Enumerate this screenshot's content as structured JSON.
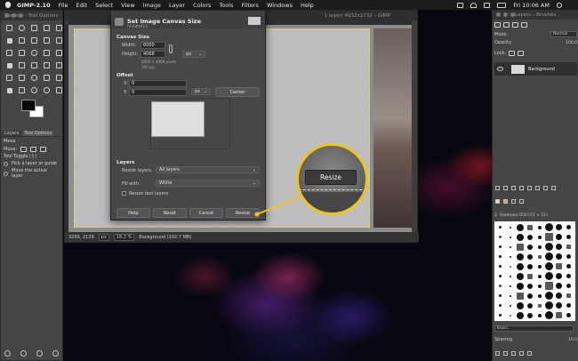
{
  "menubar": {
    "app_name": "GIMP-2.10",
    "items": [
      "File",
      "Edit",
      "Select",
      "View",
      "Image",
      "Layer",
      "Colors",
      "Tools",
      "Filters",
      "Windows",
      "Help"
    ],
    "clock": "Fri 10:06 AM"
  },
  "toolbox": {
    "title": "Toolbox - Tool Options",
    "tabs": [
      "Layers",
      "Tool Options"
    ],
    "tool_name": "Move",
    "move_label": "Move:",
    "toggle_label": "Tool Toggle  (⇧)",
    "option1": "Pick a layer or guide",
    "option2": "Move the active layer"
  },
  "image_window": {
    "title": "[Untitled]-4.0 (RGB color 8-bit gamma integer, GIMP built-in sRGB, 1 layer) 4032x2732 – GIMP",
    "title_visible": "1 layer) 4032x2732 – GIMP",
    "status": {
      "coords": "3289, 2139",
      "unit": "px",
      "zoom": "18.2 %",
      "info": "Background (102.7 MB)"
    }
  },
  "dialog": {
    "title": "Set Image Canvas Size",
    "subtitle": "[Untitled]-4",
    "canvas_size": {
      "heading": "Canvas Size",
      "width_label": "Width:",
      "width_value": "6000",
      "height_label": "Height:",
      "height_value": "4068",
      "unit": "px",
      "info_line1": "6000 × 4068 pixels",
      "info_line2": "300 ppi"
    },
    "offset": {
      "heading": "Offset",
      "x_label": "X:",
      "x_value": "0",
      "y_label": "Y:",
      "y_value": "0",
      "unit": "px",
      "center_label": "Center"
    },
    "layers": {
      "heading": "Layers",
      "resize_layers_label": "Resize layers:",
      "resize_layers_value": "All layers",
      "fill_with_label": "Fill with:",
      "fill_with_value": "White",
      "resize_text_layers_label": "Resize text layers"
    },
    "buttons": {
      "help": "Help",
      "reset": "Reset",
      "cancel": "Cancel",
      "resize": "Resize"
    }
  },
  "callout": {
    "label": "Resize",
    "accent": "#f0c419"
  },
  "layers_panel": {
    "title": "Layers – Brushes",
    "mode_label": "Mode",
    "mode_value": "Normal",
    "opacity_label": "Opacity",
    "opacity_value": "100.0",
    "lock_label": "Lock:",
    "layer_name": "Background",
    "brush_name": "2. Hardness 050 (51 × 51)",
    "preset_value": "Basic,",
    "spacing_label": "Spacing",
    "spacing_value": "10.0"
  }
}
